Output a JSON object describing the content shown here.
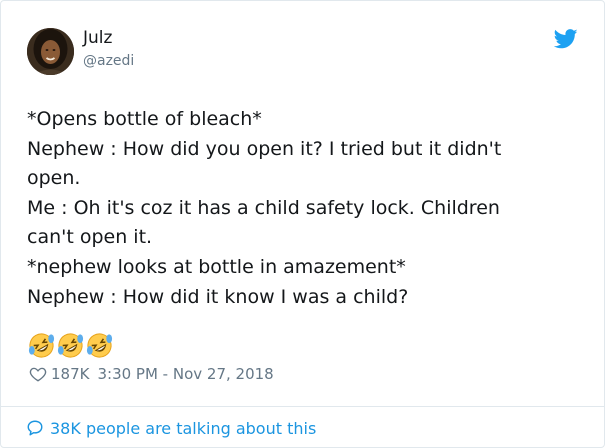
{
  "tweet": {
    "author": {
      "name": "Julz",
      "handle": "@azedi",
      "avatar_icon": "avatar-photo"
    },
    "platform_icon": "twitter-bird-icon",
    "brand_color": "#1da1f2",
    "text_lines": [
      "*Opens bottle of bleach*",
      "Nephew : How did you open it? I tried but it didn't",
      "open.",
      "Me : Oh it's coz it has a child safety lock. Children",
      "can't open it.",
      "*nephew looks at bottle in amazement*",
      "Nephew : How did it know I was a child?"
    ],
    "emojis": [
      "rolling-on-floor-laughing",
      "rolling-on-floor-laughing",
      "rolling-on-floor-laughing"
    ],
    "likes": "187K",
    "timestamp": "3:30 PM - Nov 27, 2018",
    "footer": "38K people are talking about this"
  }
}
